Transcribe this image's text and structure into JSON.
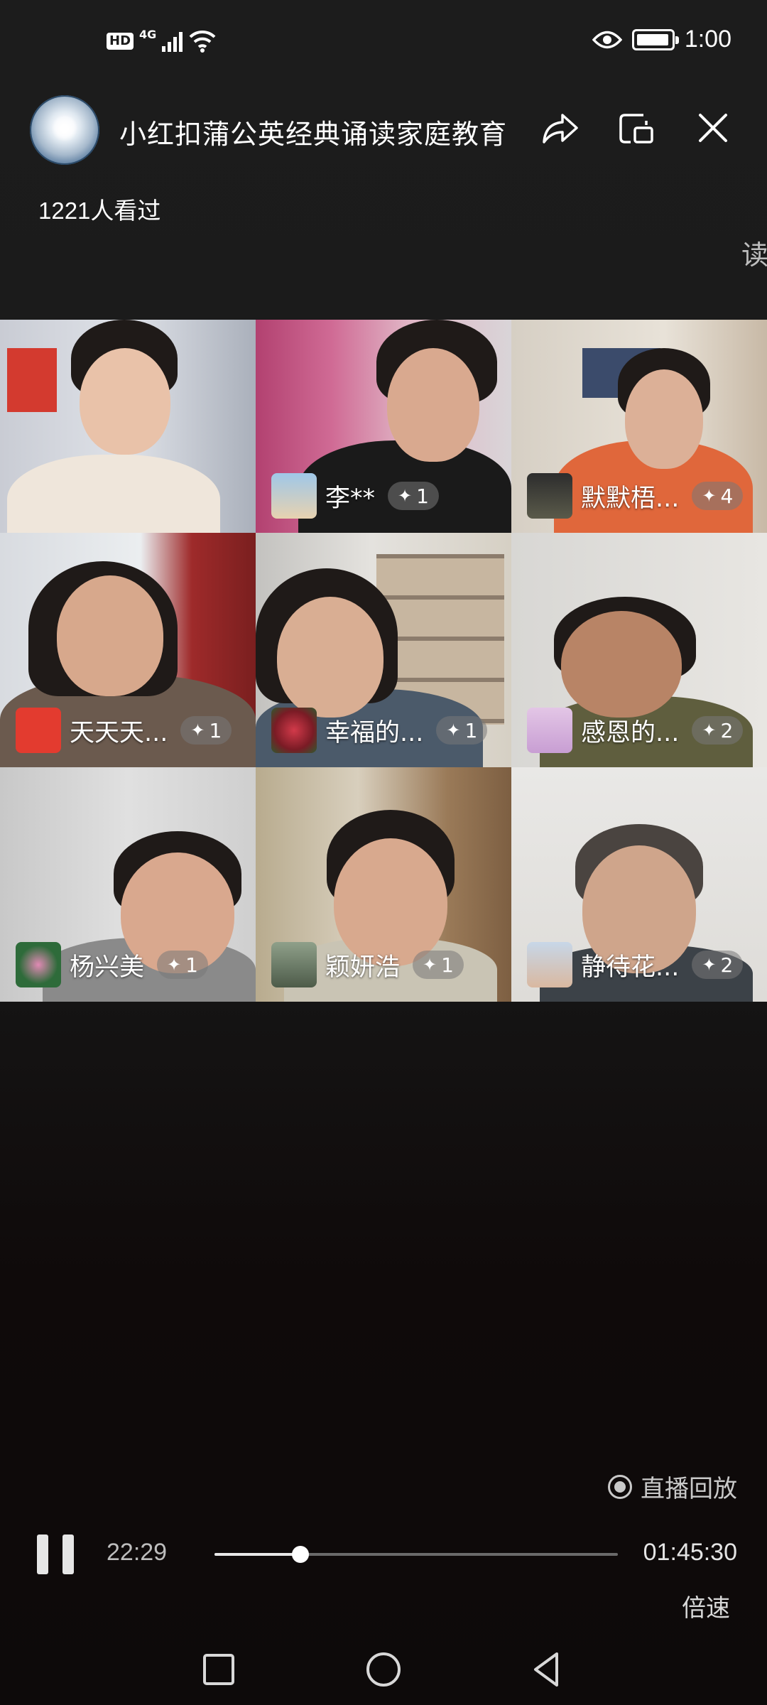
{
  "status_bar": {
    "hd": "HD",
    "network": "4G",
    "time": "1:00"
  },
  "header": {
    "channel_name": "小红扣蒲公英经典诵读家庭教育",
    "viewers": "1221人看过",
    "side_text": "读"
  },
  "participants": [
    {
      "name": "",
      "likes": ""
    },
    {
      "name": "李**",
      "likes": "1"
    },
    {
      "name": "默默梧...",
      "likes": "4"
    },
    {
      "name": "天天天...",
      "likes": "1"
    },
    {
      "name": "幸福的...",
      "likes": "1"
    },
    {
      "name": "感恩的...",
      "likes": "2"
    },
    {
      "name": "杨兴美",
      "likes": "1"
    },
    {
      "name": "颖妍浩",
      "likes": "1"
    },
    {
      "name": "静待花...",
      "likes": "2"
    }
  ],
  "player": {
    "replay_label": "直播回放",
    "current_time": "22:29",
    "total_time": "01:45:30",
    "progress": 0.213,
    "speed_label": "倍速"
  },
  "colors": {
    "background": "#1b1b1b",
    "accent": "#ffffff"
  }
}
